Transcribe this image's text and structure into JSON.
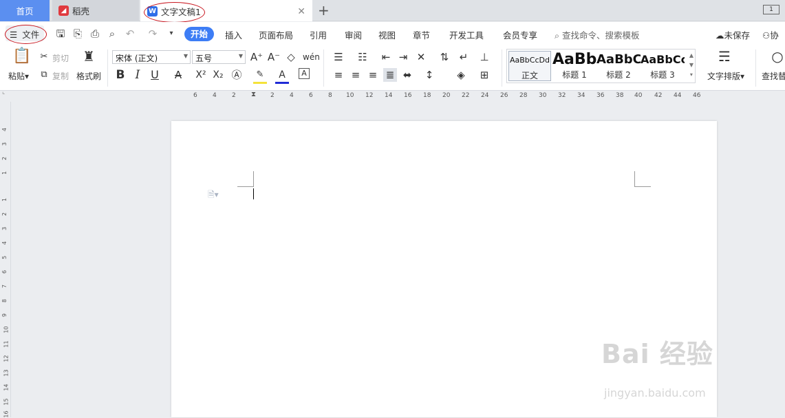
{
  "tabs": {
    "home": "首页",
    "daoke": "稻壳",
    "doc": "文字文稿1",
    "window_indicator": "1"
  },
  "menubar": {
    "file": "文件",
    "items": [
      "开始",
      "插入",
      "页面布局",
      "引用",
      "审阅",
      "视图",
      "章节",
      "开发工具",
      "会员专享"
    ],
    "search_placeholder": "查找命令、搜索模板",
    "unsaved": "未保存",
    "collab": "协"
  },
  "toolbar": {
    "paste": "粘贴",
    "cut": "剪切",
    "copy": "复制",
    "format_painter": "格式刷",
    "font_name": "宋体 (正文)",
    "font_size": "五号",
    "styles": [
      {
        "preview": "AaBbCcDd",
        "label": "正文"
      },
      {
        "preview": "AaBb",
        "label": "标题 1"
      },
      {
        "preview": "AaBbC",
        "label": "标题 2"
      },
      {
        "preview": "AaBbCc",
        "label": "标题 3"
      }
    ],
    "text_layout": "文字排版",
    "find_replace": "查找替"
  },
  "ruler": {
    "h_ticks": [
      "6",
      "4",
      "2",
      "2",
      "4",
      "6",
      "8",
      "10",
      "12",
      "14",
      "16",
      "18",
      "20",
      "22",
      "24",
      "26",
      "28",
      "30",
      "32",
      "34",
      "36",
      "38",
      "40",
      "42",
      "44",
      "46"
    ],
    "v_ticks": [
      "4",
      "3",
      "2",
      "1",
      "1",
      "2",
      "3",
      "4",
      "5",
      "6",
      "7",
      "8",
      "9",
      "10",
      "11",
      "12",
      "13",
      "14",
      "15",
      "16"
    ]
  },
  "watermark": {
    "main": "Bai 经验",
    "sub": "jingyan.baidu.com"
  },
  "colors": {
    "accent": "#3d7df5",
    "home_tab": "#5b8ff0",
    "annotation": "#c8151e"
  }
}
